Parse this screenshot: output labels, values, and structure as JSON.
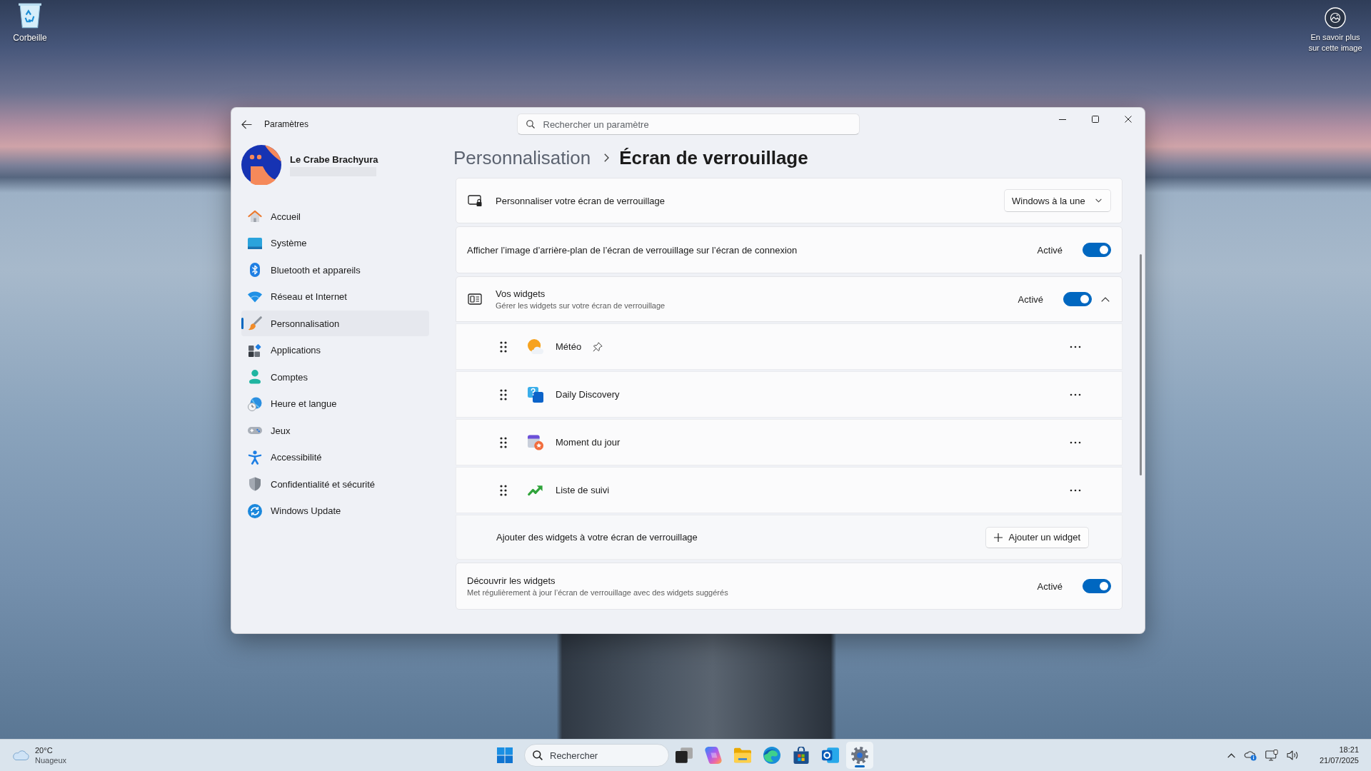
{
  "desktop": {
    "icons": [
      {
        "label": "Corbeille"
      }
    ],
    "spotlight": {
      "label": "En savoir plus sur cette image"
    }
  },
  "window": {
    "title": "Paramètres",
    "search": {
      "placeholder": "Rechercher un paramètre"
    }
  },
  "account": {
    "name": "Le Crabe Brachyura"
  },
  "sidebar": {
    "items": [
      {
        "label": "Accueil",
        "selected": false
      },
      {
        "label": "Système",
        "selected": false
      },
      {
        "label": "Bluetooth et appareils",
        "selected": false
      },
      {
        "label": "Réseau et Internet",
        "selected": false
      },
      {
        "label": "Personnalisation",
        "selected": true
      },
      {
        "label": "Applications",
        "selected": false
      },
      {
        "label": "Comptes",
        "selected": false
      },
      {
        "label": "Heure et langue",
        "selected": false
      },
      {
        "label": "Jeux",
        "selected": false
      },
      {
        "label": "Accessibilité",
        "selected": false
      },
      {
        "label": "Confidentialité et sécurité",
        "selected": false
      },
      {
        "label": "Windows Update",
        "selected": false
      }
    ]
  },
  "breadcrumb": {
    "parent": "Personnalisation",
    "current": "Écran de verrouillage"
  },
  "settings": [
    {
      "kind": "dropdown",
      "label": "Personnaliser votre écran de verrouillage",
      "value": "Windows à la une"
    },
    {
      "kind": "toggle",
      "label": "Afficher l’image d’arrière-plan de l’écran de verrouillage sur l’écran de connexion",
      "state_label": "Activé",
      "on": true
    },
    {
      "kind": "expander",
      "label": "Vos widgets",
      "description": "Gérer les widgets sur votre écran de verrouillage",
      "state_label": "Activé",
      "on": true,
      "expanded": true,
      "widgets": [
        {
          "name": "Météo",
          "pinned": true
        },
        {
          "name": "Daily Discovery",
          "pinned": false
        },
        {
          "name": "Moment du jour",
          "pinned": false
        },
        {
          "name": "Liste de suivi",
          "pinned": false
        }
      ],
      "add_row": {
        "label": "Ajouter des widgets à votre écran de verrouillage",
        "button": "Ajouter un widget"
      }
    },
    {
      "kind": "toggle",
      "label": "Découvrir les widgets",
      "description": "Met régulièrement à jour l’écran de verrouillage avec des widgets suggérés",
      "state_label": "Activé",
      "on": true
    }
  ],
  "taskbar": {
    "weather": {
      "temperature": "20°C",
      "condition": "Nuageux"
    },
    "search": {
      "placeholder": "Rechercher"
    },
    "apps": [
      {
        "active": false
      },
      {
        "active": false
      },
      {
        "active": false
      },
      {
        "active": false
      },
      {
        "active": false
      },
      {
        "active": false
      },
      {
        "active": true
      }
    ],
    "clock": {
      "time": "18:21",
      "date": "21/07/2025"
    }
  }
}
